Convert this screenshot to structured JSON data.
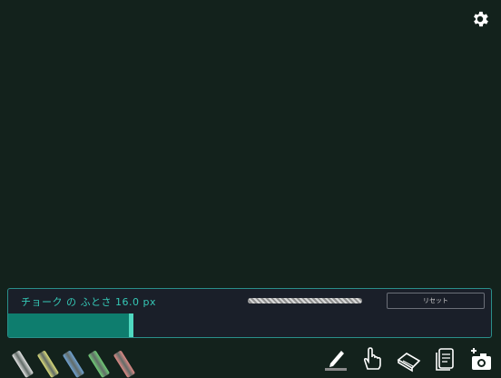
{
  "settings": {
    "icon": "gear-icon"
  },
  "chalk_width": {
    "label": "チョーク の ふとさ 16.0 px",
    "value": 16.0,
    "unit": "px",
    "slider_fraction": 0.255
  },
  "reset_button": {
    "label": "リセット"
  },
  "chalks": [
    {
      "name": "white",
      "color": "#e8e8e8"
    },
    {
      "name": "yellow",
      "color": "#dfe07a"
    },
    {
      "name": "blue",
      "color": "#6fa3d6"
    },
    {
      "name": "green",
      "color": "#6fce76"
    },
    {
      "name": "red",
      "color": "#e28a86"
    }
  ],
  "toolbar": [
    {
      "name": "chalk-pencil-icon"
    },
    {
      "name": "hand-pointer-icon"
    },
    {
      "name": "eraser-icon"
    },
    {
      "name": "clear-board-icon"
    },
    {
      "name": "add-photo-camera-icon"
    }
  ],
  "colors": {
    "board": "#13221c",
    "accent": "#35c8b6",
    "panel_border": "#2a8f8a",
    "slider_fill": "#0e7d6e",
    "icon": "#ffffff"
  }
}
